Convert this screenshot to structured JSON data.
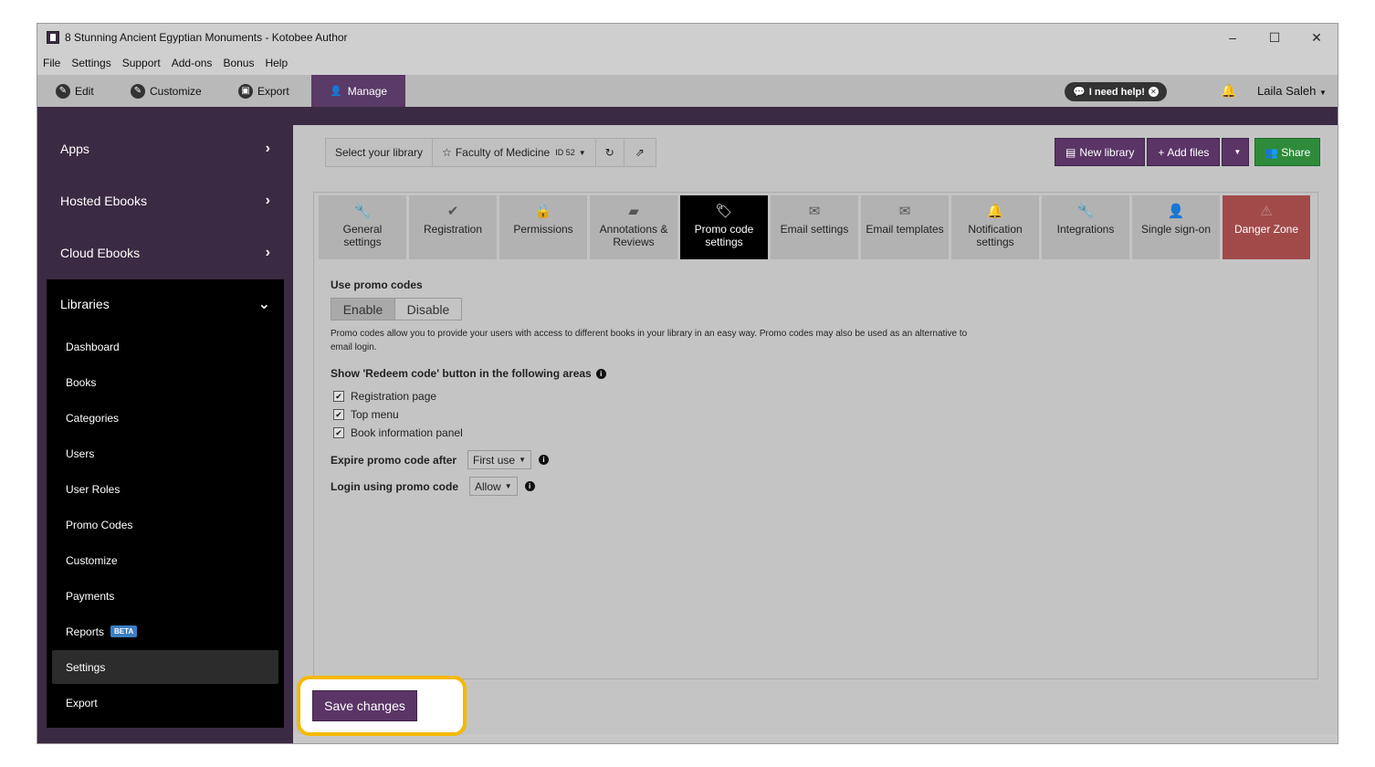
{
  "window": {
    "title": "8 Stunning Ancient Egyptian Monuments - Kotobee Author",
    "controls": [
      "–",
      "☐",
      "✕"
    ]
  },
  "menubar": [
    "File",
    "Settings",
    "Support",
    "Add-ons",
    "Bonus",
    "Help"
  ],
  "main_tabs": [
    {
      "label": "Edit",
      "icon": "pencil-icon",
      "glyph": "✎"
    },
    {
      "label": "Customize",
      "icon": "wrench-icon",
      "glyph": "🔧"
    },
    {
      "label": "Export",
      "icon": "export-icon",
      "glyph": "⎙"
    },
    {
      "label": "Manage",
      "icon": "user-icon",
      "glyph": "👤",
      "active": true
    }
  ],
  "header": {
    "help_label": "I need help!",
    "user_name": "Laila Saleh"
  },
  "sidebar": {
    "sections": [
      "Apps",
      "Hosted Ebooks",
      "Cloud Ebooks"
    ],
    "libraries": {
      "label": "Libraries",
      "items": [
        "Dashboard",
        "Books",
        "Categories",
        "Users",
        "User Roles",
        "Promo Codes",
        "Customize",
        "Payments",
        "Reports",
        "Settings",
        "Export"
      ],
      "beta_badge": "BETA",
      "active_item": "Settings"
    }
  },
  "toolbar": {
    "select_label": "Select your library",
    "library_name": "Faculty of Medicine",
    "library_id": "ID 52",
    "new_library": "New library",
    "add_files": "Add files",
    "share": "Share"
  },
  "settings_tabs": [
    {
      "label": "General settings",
      "glyph": "🔧"
    },
    {
      "label": "Registration",
      "glyph": "✔"
    },
    {
      "label": "Permissions",
      "glyph": "🔒"
    },
    {
      "label": "Annotations & Reviews",
      "glyph": "▰"
    },
    {
      "label": "Promo code settings",
      "glyph": "🏷",
      "active": true
    },
    {
      "label": "Email settings",
      "glyph": "✉"
    },
    {
      "label": "Email templates",
      "glyph": "✉"
    },
    {
      "label": "Notification settings",
      "glyph": "🔔"
    },
    {
      "label": "Integrations",
      "glyph": "🔧"
    },
    {
      "label": "Single sign-on",
      "glyph": "👤"
    },
    {
      "label": "Danger Zone",
      "glyph": "⚠",
      "danger": true
    }
  ],
  "promo_form": {
    "use_label": "Use promo codes",
    "enable": "Enable",
    "disable": "Disable",
    "description": "Promo codes allow you to provide your users with access to different books in your library in an easy way. Promo codes may also be used as an alternative to email login.",
    "redeem_label": "Show 'Redeem code' button in the following areas",
    "areas": [
      "Registration page",
      "Top menu",
      "Book information panel"
    ],
    "expire_label": "Expire promo code after",
    "expire_value": "First use",
    "login_label": "Login using promo code",
    "login_value": "Allow"
  },
  "save_label": "Save changes",
  "colors": {
    "accent": "#5a3566",
    "sidebar": "#3b2a44",
    "share_green": "#2e8b3a",
    "danger": "#a24a4a",
    "highlight": "#f5b800"
  }
}
